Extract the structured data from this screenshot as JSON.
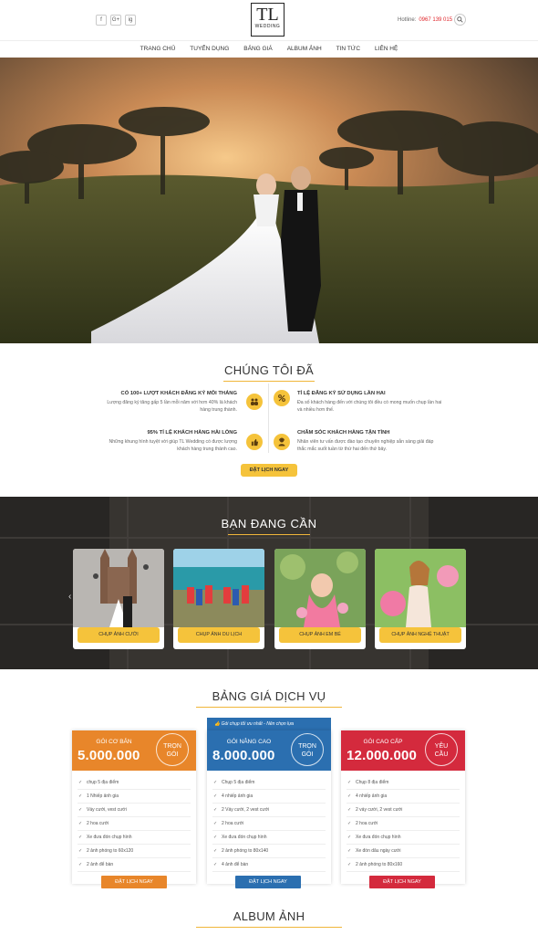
{
  "header": {
    "social": [
      "f",
      "G+",
      "ig"
    ],
    "logo_main": "TL",
    "logo_sub": "WEDDING",
    "hotline_label": "Hotline:",
    "hotline_number": "0967 139 015"
  },
  "nav": [
    "TRANG CHỦ",
    "TUYỂN DỤNG",
    "BẢNG GIÁ",
    "ALBUM ẢNH",
    "TIN TỨC",
    "LIÊN HỆ"
  ],
  "achievements": {
    "title": "CHÚNG TÔI ĐÃ",
    "items": [
      {
        "heading": "CÓ 100+ LƯỢT KHÁCH ĐĂNG KÝ MỖI THÁNG",
        "text": "Lượng đăng ký tăng gấp 5 lần mỗi năm với hơn 40% là khách hàng trung thành."
      },
      {
        "heading": "TỈ LỆ ĐĂNG KÝ SỬ DỤNG LẦN HAI",
        "text": "Đa số khách hàng đến với chúng tôi đều có mong muốn chụp lần hai và nhiều hơn thế."
      },
      {
        "heading": "95% TỈ LỆ KHÁCH HÀNG HÀI LÒNG",
        "text": "Những khung hình tuyệt vời giúp TL Wedding có được lượng khách hàng trung thành cao."
      },
      {
        "heading": "CHĂM SÓC KHÁCH HÀNG TẬN TÌNH",
        "text": "Nhân viên tư vấn được đào tạo chuyên nghiệp sẵn sàng giải đáp thắc mắc suốt tuần từ thứ hai đến thứ bảy."
      }
    ],
    "cta": "ĐẶT LỊCH NGAY"
  },
  "needs": {
    "title": "BẠN ĐANG CẦN",
    "cards": [
      "CHỤP ẢNH CƯỚI",
      "CHỤP ẢNH DU LỊCH",
      "CHỤP ẢNH EM BÉ",
      "CHỤP ẢNH NGHỆ THUẬT"
    ]
  },
  "pricing": {
    "title": "BẢNG GIÁ DỊCH VỤ",
    "ribbon": "Gói chụp tối ưu nhất - Nên chọn lựa",
    "plans": [
      {
        "name": "GÓI CƠ BẢN",
        "price": "5.000.000",
        "badge_top": "TRỌN",
        "badge_bottom": "GÓI",
        "color": "#e8862a",
        "features": [
          "chụp 5 địa điểm",
          "1 Nhiếp ảnh gia",
          "Váy cưới, vest cưới",
          "2 hoa cưới",
          "Xe đưa đón chụp hình",
          "2 ảnh phóng to 60x120",
          "2 ảnh để bàn"
        ],
        "button": "ĐẶT LỊCH NGAY"
      },
      {
        "name": "GÓI NÂNG CAO",
        "price": "8.000.000",
        "badge_top": "TRỌN",
        "badge_bottom": "GÓI",
        "color": "#2b6fb0",
        "features": [
          "Chụp 5 địa điểm",
          "4 nhiếp ảnh gia",
          "2 Váy cưới, 2 vest cưới",
          "2 hoa cưới",
          "Xe đưa đón chụp hình",
          "2 ảnh phóng to 80x140",
          "4 ảnh để bàn"
        ],
        "button": "ĐẶT LỊCH NGAY"
      },
      {
        "name": "GÓI CAO CẤP",
        "price": "12.000.000",
        "badge_top": "YÊU",
        "badge_bottom": "CẦU",
        "color": "#d42a3d",
        "features": [
          "Chụp 8 địa điểm",
          "4 nhiếp ảnh gia",
          "2 váy cưới, 2 vest cưới",
          "2 hoa cưới",
          "Xe đưa đón chụp hình",
          "Xe đón dâu ngày cưới",
          "2 ảnh phóng to 80x160"
        ],
        "button": "ĐẶT LỊCH NGAY"
      }
    ]
  },
  "album": {
    "title": "ALBUM ẢNH"
  },
  "colors": {
    "accent": "#f5c33b",
    "orange": "#e8862a",
    "blue": "#2b6fb0",
    "red": "#d42a3d",
    "hotline": "#e0262b"
  }
}
